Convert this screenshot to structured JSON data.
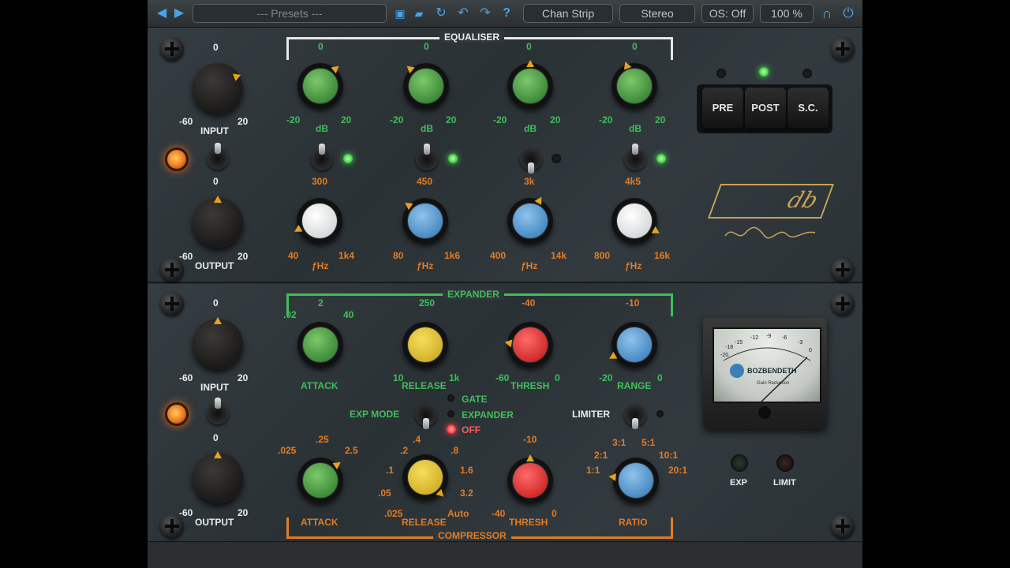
{
  "toolbar": {
    "presets": "--- Presets ---",
    "chan_strip": "Chan Strip",
    "stereo": "Stereo",
    "os": "OS: Off",
    "zoom": "100 %",
    "help": "?"
  },
  "eq": {
    "title": "EQUALISER",
    "input": {
      "label": "INPUT",
      "top": "0",
      "min": "-60",
      "max": "20"
    },
    "output": {
      "label": "OUTPUT",
      "top": "0",
      "min": "-60",
      "max": "20"
    },
    "gain_knobs": [
      {
        "top": "0",
        "min": "-20",
        "max": "20",
        "unit": "dB"
      },
      {
        "top": "0",
        "min": "-20",
        "max": "20",
        "unit": "dB"
      },
      {
        "top": "0",
        "min": "-20",
        "max": "20",
        "unit": "dB"
      },
      {
        "top": "0",
        "min": "-20",
        "max": "20",
        "unit": "dB"
      }
    ],
    "freq_knobs": [
      {
        "top": "300",
        "min": "40",
        "max": "1k4",
        "unit": "ƒHz"
      },
      {
        "top": "450",
        "min": "80",
        "max": "1k6",
        "unit": "ƒHz"
      },
      {
        "top": "3k",
        "min": "400",
        "max": "14k",
        "unit": "ƒHz"
      },
      {
        "top": "4k5",
        "min": "800",
        "max": "16k",
        "unit": "ƒHz"
      }
    ],
    "routing": {
      "pre": "PRE",
      "post": "POST",
      "sc": "S.C."
    },
    "logo": "db"
  },
  "comp": {
    "expander_title": "EXPANDER",
    "compressor_title": "COMPRESSOR",
    "input": {
      "label": "INPUT",
      "top": "0",
      "min": "-60",
      "max": "20"
    },
    "output": {
      "label": "OUTPUT",
      "top": "0",
      "min": "-60",
      "max": "20"
    },
    "exp_knobs": [
      {
        "label": "ATTACK",
        "top": "2",
        "left": ".02",
        "right": "40"
      },
      {
        "label": "RELEASE",
        "top": "250",
        "left": "10",
        "right": "1k"
      },
      {
        "label": "THRESH",
        "top": "-40",
        "left": "-60",
        "right": "0"
      },
      {
        "label": "RANGE",
        "top": "-10",
        "left": "-20",
        "right": "0"
      }
    ],
    "exp_mode": {
      "label": "EXP MODE",
      "gate": "GATE",
      "expander": "EXPANDER",
      "off": "OFF"
    },
    "limiter": "LIMITER",
    "comp_attack": {
      "label": "ATTACK",
      "v1": ".025",
      "v2": ".25",
      "v3": "2.5"
    },
    "comp_release": {
      "label": "RELEASE",
      "v1": ".025",
      "v2": ".05",
      "v3": ".1",
      "v4": ".2",
      "v5": ".4",
      "v6": ".8",
      "v7": "1.6",
      "v8": "3.2",
      "v9": "Auto"
    },
    "comp_thresh": {
      "label": "THRESH",
      "top": "-10",
      "left": "-40",
      "right": "0"
    },
    "comp_ratio": {
      "label": "RATIO",
      "r1": "1:1",
      "r2": "2:1",
      "r3": "3:1",
      "r4": "5:1",
      "r5": "10:1",
      "r6": "20:1"
    },
    "meter": {
      "brand": "BOZBENDETH",
      "sub": "Gain Reduction",
      "scale": [
        "-20",
        "-18",
        "-15",
        "-12",
        "-9",
        "-6",
        "-3",
        "0"
      ]
    },
    "exp_led": "EXP",
    "limit_led": "LIMIT"
  },
  "colors": {
    "green": "#3fbf58",
    "orange": "#e07c27",
    "accent_blue": "#4aa3e8"
  }
}
